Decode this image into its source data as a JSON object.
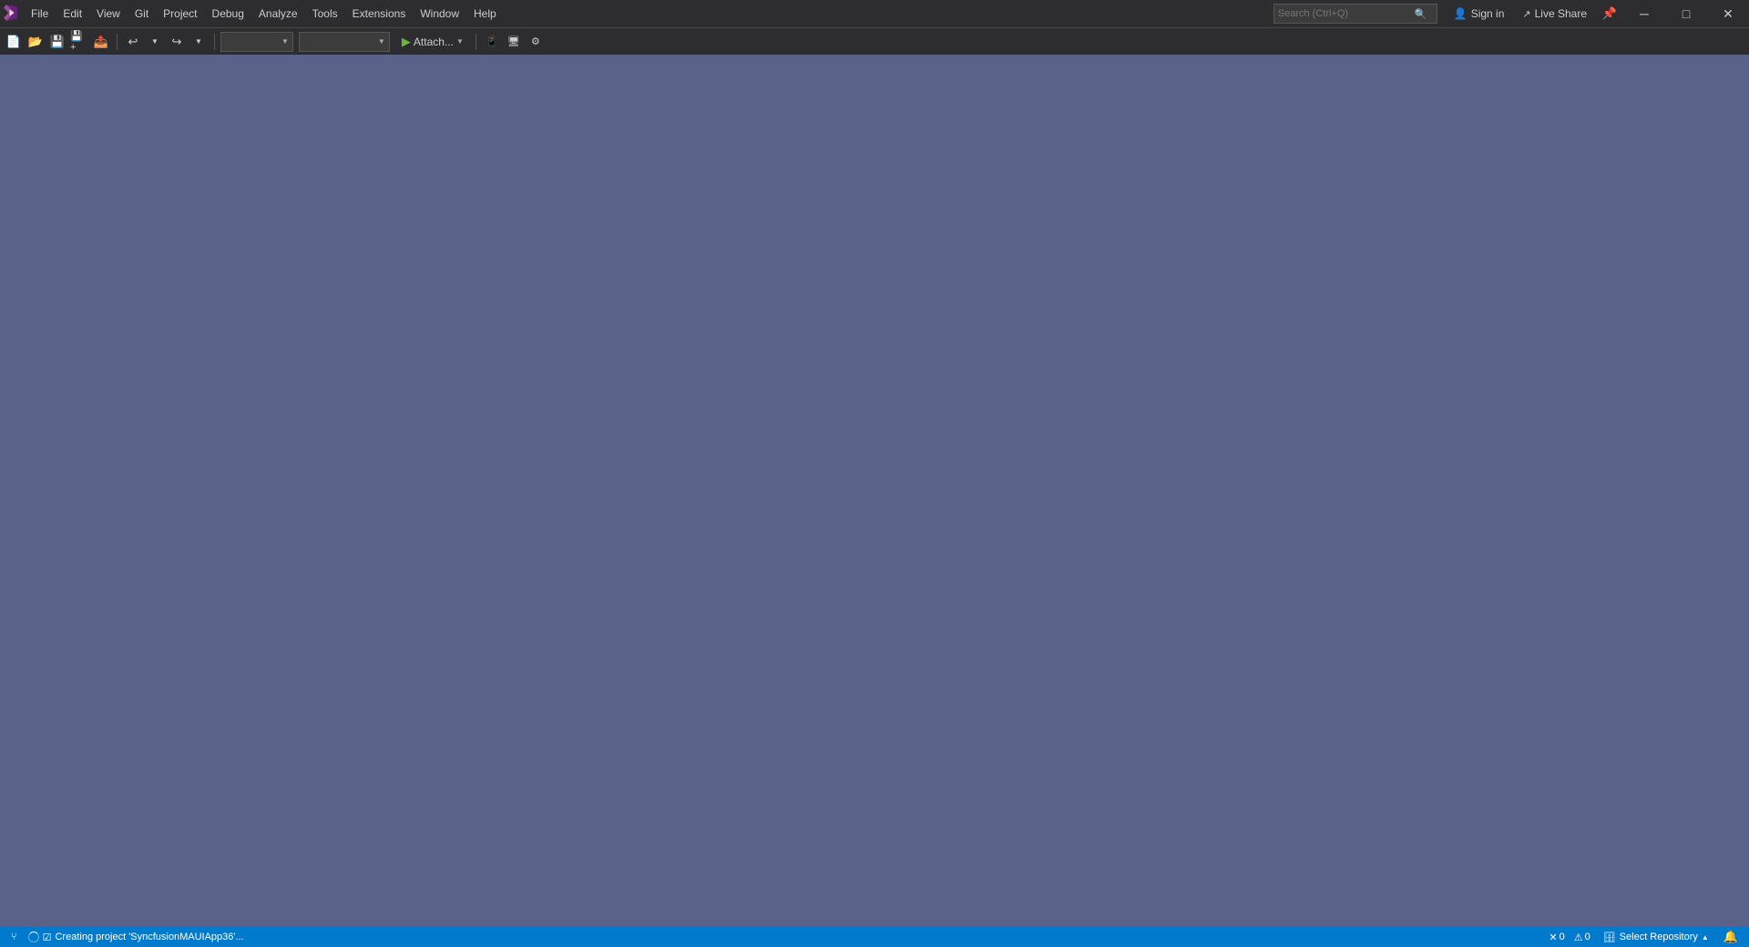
{
  "titlebar": {
    "menu_items": [
      "File",
      "Edit",
      "View",
      "Git",
      "Project",
      "Debug",
      "Analyze",
      "Tools",
      "Extensions",
      "Window",
      "Help"
    ],
    "search_placeholder": "Search (Ctrl+Q)",
    "sign_in_label": "Sign in",
    "live_share_label": "Live Share"
  },
  "toolbar": {
    "attach_label": "Attach...",
    "config_dropdown": "",
    "platform_dropdown": ""
  },
  "statusbar": {
    "creating_label": "Creating project 'SyncfusionMAUIApp36'...",
    "select_repo_label": "Select Repository",
    "git_icon": "⑂",
    "error_count": "0",
    "warning_count": "0"
  },
  "window_controls": {
    "minimize": "─",
    "maximize": "□",
    "close": "✕"
  }
}
